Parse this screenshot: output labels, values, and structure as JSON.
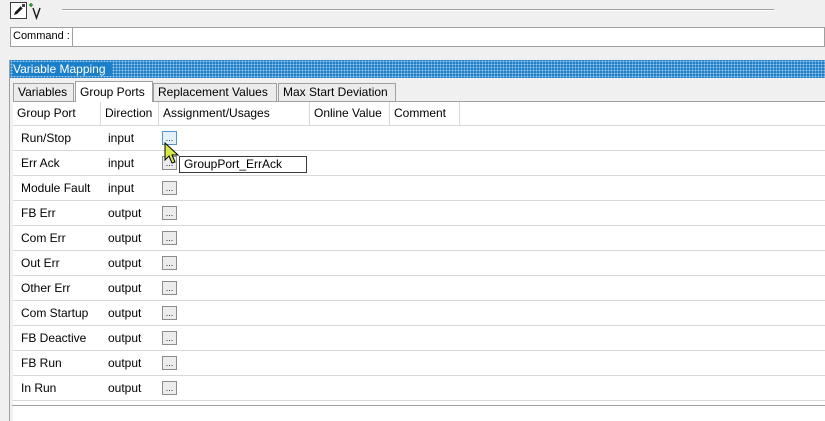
{
  "toolbar": {
    "icons": [
      "edit-pencil-icon",
      "add-variable-icon"
    ]
  },
  "command": {
    "label": "Command :",
    "value": "",
    "placeholder": ""
  },
  "panel": {
    "title": "Variable Mapping"
  },
  "tabs": [
    {
      "label": "Variables",
      "active": false
    },
    {
      "label": "Group Ports",
      "active": true
    },
    {
      "label": "Replacement Values",
      "active": false
    },
    {
      "label": "Max Start Deviation",
      "active": false
    }
  ],
  "table": {
    "columns": [
      "Group Port",
      "Direction",
      "Assignment/Usages",
      "Online Value",
      "Comment"
    ],
    "rows": [
      {
        "port": "Run/Stop",
        "direction": "input",
        "button": "..."
      },
      {
        "port": "Err Ack",
        "direction": "input",
        "button": "..."
      },
      {
        "port": "Module Fault",
        "direction": "input",
        "button": "..."
      },
      {
        "port": "FB Err",
        "direction": "output",
        "button": "..."
      },
      {
        "port": "Com Err",
        "direction": "output",
        "button": "..."
      },
      {
        "port": "Out Err",
        "direction": "output",
        "button": "..."
      },
      {
        "port": "Other Err",
        "direction": "output",
        "button": "..."
      },
      {
        "port": "Com Startup",
        "direction": "output",
        "button": "..."
      },
      {
        "port": "FB Deactive",
        "direction": "output",
        "button": "..."
      },
      {
        "port": "FB Run",
        "direction": "output",
        "button": "..."
      },
      {
        "port": "In Run",
        "direction": "output",
        "button": "..."
      }
    ]
  },
  "tooltip": {
    "text": "GroupPort_ErrAck"
  },
  "colors": {
    "title_bar": "#1c7fc9",
    "hover_button": "#e4f1fb"
  }
}
